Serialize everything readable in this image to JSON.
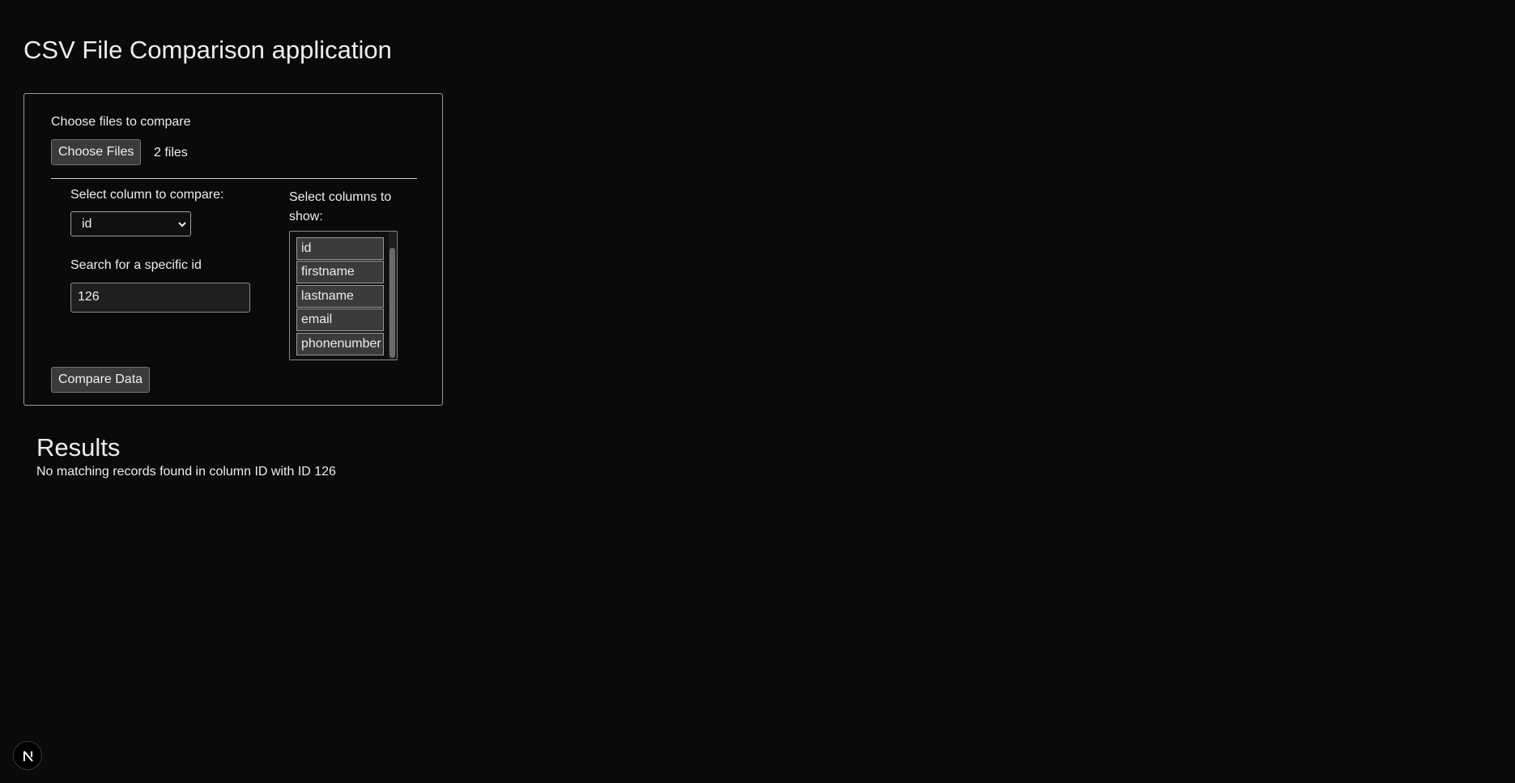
{
  "page": {
    "title": "CSV File Comparison application"
  },
  "form": {
    "choose_label": "Choose files to compare",
    "choose_button": "Choose Files",
    "files_count": "2 files",
    "compare_column_label": "Select column to compare:",
    "compare_column_value": "id",
    "search_label": "Search for a specific id",
    "search_value": "126",
    "show_columns_label": "Select columns to show:",
    "columns": [
      {
        "label": "id"
      },
      {
        "label": "firstname"
      },
      {
        "label": "lastname"
      },
      {
        "label": "email"
      },
      {
        "label": "phonenumber"
      }
    ],
    "compare_button": "Compare Data"
  },
  "results": {
    "heading": "Results",
    "message": "No matching records found in column ID with ID 126"
  },
  "icons": {
    "select_chevron": "chevron-down-icon",
    "dev_badge": "nextjs-logo-icon"
  },
  "colors": {
    "background": "#0a0a0a",
    "text": "#ededed",
    "button_bg": "#3b3b3b",
    "panel_border": "#9a9a9a"
  }
}
